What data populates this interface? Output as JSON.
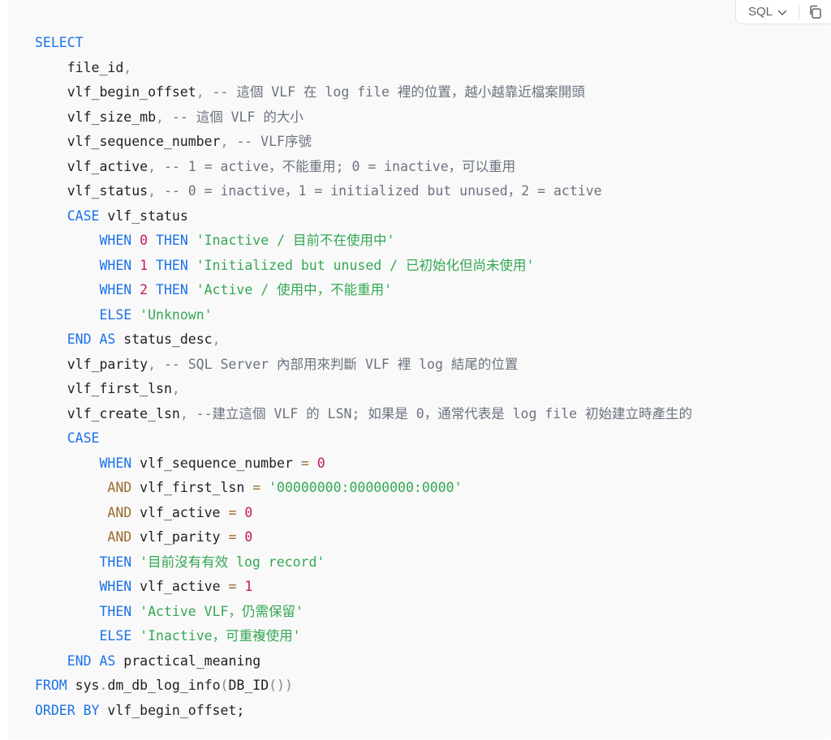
{
  "toolbar": {
    "language": "SQL"
  },
  "colors": {
    "keyword": "#1a73e8",
    "operator": "#9a6b2f",
    "number": "#c2185b",
    "string": "#34a853",
    "comment": "#6b7280",
    "punctuation": "#8a8a8a",
    "text": "#1f1f1f"
  },
  "code_lines": [
    [
      [
        "kw",
        "SELECT"
      ]
    ],
    [
      [
        "txt",
        "    file_id"
      ],
      [
        "pun",
        ","
      ]
    ],
    [
      [
        "txt",
        "    vlf_begin_offset"
      ],
      [
        "pun",
        ","
      ],
      [
        "cmt",
        " -- 這個 VLF 在 log file 裡的位置，越小越靠近檔案開頭"
      ]
    ],
    [
      [
        "txt",
        "    vlf_size_mb"
      ],
      [
        "pun",
        ","
      ],
      [
        "cmt",
        " -- 這個 VLF 的大小"
      ]
    ],
    [
      [
        "txt",
        "    vlf_sequence_number"
      ],
      [
        "pun",
        ","
      ],
      [
        "cmt",
        " -- VLF序號"
      ]
    ],
    [
      [
        "txt",
        "    vlf_active"
      ],
      [
        "pun",
        ","
      ],
      [
        "cmt",
        " -- 1 = active，不能重用; 0 = inactive，可以重用"
      ]
    ],
    [
      [
        "txt",
        "    vlf_status"
      ],
      [
        "pun",
        ","
      ],
      [
        "cmt",
        " -- 0 = inactive，1 = initialized but unused，2 = active"
      ]
    ],
    [
      [
        "txt",
        "    "
      ],
      [
        "kw",
        "CASE"
      ],
      [
        "txt",
        " vlf_status"
      ]
    ],
    [
      [
        "txt",
        "        "
      ],
      [
        "kw",
        "WHEN"
      ],
      [
        "txt",
        " "
      ],
      [
        "num",
        "0"
      ],
      [
        "txt",
        " "
      ],
      [
        "kw",
        "THEN"
      ],
      [
        "txt",
        " "
      ],
      [
        "str",
        "'Inactive / 目前不在使用中'"
      ]
    ],
    [
      [
        "txt",
        "        "
      ],
      [
        "kw",
        "WHEN"
      ],
      [
        "txt",
        " "
      ],
      [
        "num",
        "1"
      ],
      [
        "txt",
        " "
      ],
      [
        "kw",
        "THEN"
      ],
      [
        "txt",
        " "
      ],
      [
        "str",
        "'Initialized but unused / 已初始化但尚未使用'"
      ]
    ],
    [
      [
        "txt",
        "        "
      ],
      [
        "kw",
        "WHEN"
      ],
      [
        "txt",
        " "
      ],
      [
        "num",
        "2"
      ],
      [
        "txt",
        " "
      ],
      [
        "kw",
        "THEN"
      ],
      [
        "txt",
        " "
      ],
      [
        "str",
        "'Active / 使用中，不能重用'"
      ]
    ],
    [
      [
        "txt",
        "        "
      ],
      [
        "kw",
        "ELSE"
      ],
      [
        "txt",
        " "
      ],
      [
        "str",
        "'Unknown'"
      ]
    ],
    [
      [
        "txt",
        "    "
      ],
      [
        "kw",
        "END"
      ],
      [
        "txt",
        " "
      ],
      [
        "kw",
        "AS"
      ],
      [
        "txt",
        " status_desc"
      ],
      [
        "pun",
        ","
      ]
    ],
    [
      [
        "txt",
        "    vlf_parity"
      ],
      [
        "pun",
        ","
      ],
      [
        "cmt",
        " -- SQL Server 內部用來判斷 VLF 裡 log 結尾的位置"
      ]
    ],
    [
      [
        "txt",
        "    vlf_first_lsn"
      ],
      [
        "pun",
        ","
      ]
    ],
    [
      [
        "txt",
        "    vlf_create_lsn"
      ],
      [
        "pun",
        ","
      ],
      [
        "cmt",
        " --建立這個 VLF 的 LSN; 如果是 0，通常代表是 log file 初始建立時產生的"
      ]
    ],
    [
      [
        "txt",
        "    "
      ],
      [
        "kw",
        "CASE"
      ]
    ],
    [
      [
        "txt",
        "        "
      ],
      [
        "kw",
        "WHEN"
      ],
      [
        "txt",
        " vlf_sequence_number "
      ],
      [
        "op",
        "="
      ],
      [
        "txt",
        " "
      ],
      [
        "num",
        "0"
      ]
    ],
    [
      [
        "txt",
        "         "
      ],
      [
        "op",
        "AND"
      ],
      [
        "txt",
        " vlf_first_lsn "
      ],
      [
        "op",
        "="
      ],
      [
        "txt",
        " "
      ],
      [
        "str",
        "'00000000:00000000:0000'"
      ]
    ],
    [
      [
        "txt",
        "         "
      ],
      [
        "op",
        "AND"
      ],
      [
        "txt",
        " vlf_active "
      ],
      [
        "op",
        "="
      ],
      [
        "txt",
        " "
      ],
      [
        "num",
        "0"
      ]
    ],
    [
      [
        "txt",
        "         "
      ],
      [
        "op",
        "AND"
      ],
      [
        "txt",
        " vlf_parity "
      ],
      [
        "op",
        "="
      ],
      [
        "txt",
        " "
      ],
      [
        "num",
        "0"
      ]
    ],
    [
      [
        "txt",
        "        "
      ],
      [
        "kw",
        "THEN"
      ],
      [
        "txt",
        " "
      ],
      [
        "str",
        "'目前沒有有效 log record'"
      ]
    ],
    [
      [
        "txt",
        "        "
      ],
      [
        "kw",
        "WHEN"
      ],
      [
        "txt",
        " vlf_active "
      ],
      [
        "op",
        "="
      ],
      [
        "txt",
        " "
      ],
      [
        "num",
        "1"
      ]
    ],
    [
      [
        "txt",
        "        "
      ],
      [
        "kw",
        "THEN"
      ],
      [
        "txt",
        " "
      ],
      [
        "str",
        "'Active VLF，仍需保留'"
      ]
    ],
    [
      [
        "txt",
        "        "
      ],
      [
        "kw",
        "ELSE"
      ],
      [
        "txt",
        " "
      ],
      [
        "str",
        "'Inactive，可重複使用'"
      ]
    ],
    [
      [
        "txt",
        "    "
      ],
      [
        "kw",
        "END"
      ],
      [
        "txt",
        " "
      ],
      [
        "kw",
        "AS"
      ],
      [
        "txt",
        " practical_meaning"
      ]
    ],
    [
      [
        "kw",
        "FROM"
      ],
      [
        "txt",
        " sys"
      ],
      [
        "pun",
        "."
      ],
      [
        "txt",
        "dm_db_log_info"
      ],
      [
        "pun",
        "("
      ],
      [
        "txt",
        "DB_ID"
      ],
      [
        "pun",
        "())"
      ]
    ],
    [
      [
        "kw",
        "ORDER BY"
      ],
      [
        "txt",
        " vlf_begin_offset;"
      ]
    ]
  ]
}
